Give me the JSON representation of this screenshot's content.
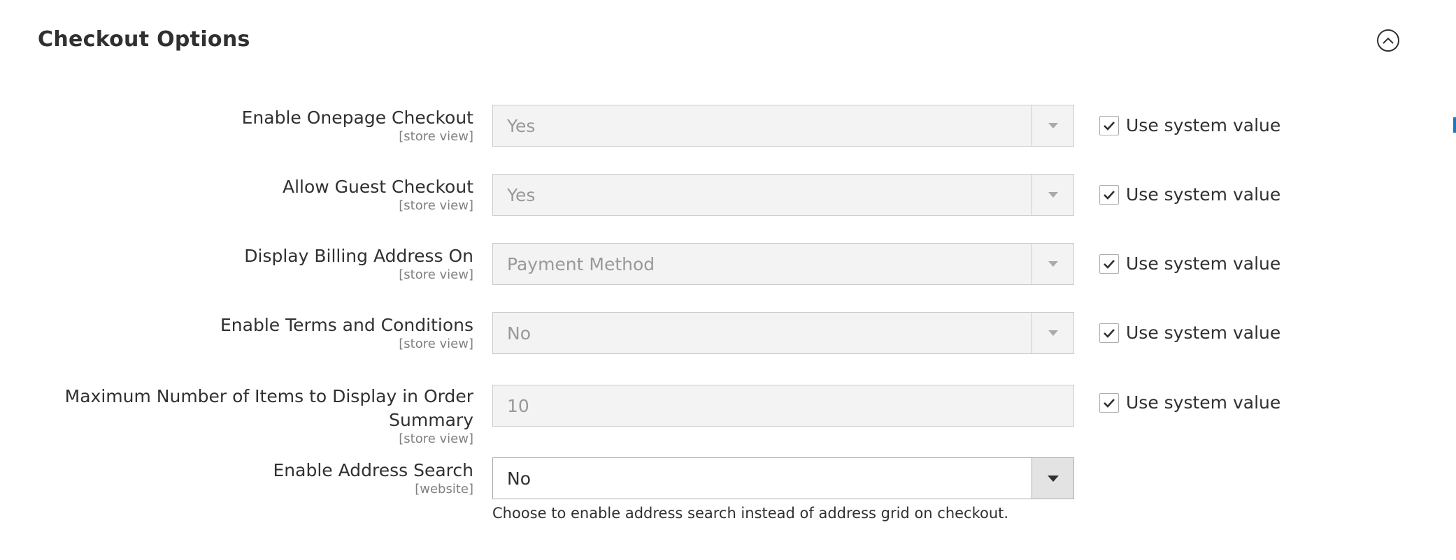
{
  "section": {
    "title": "Checkout Options"
  },
  "fields": [
    {
      "label": "Enable Onepage Checkout",
      "scope": "[store view]",
      "value": "Yes",
      "use_system_value": "Use system value"
    },
    {
      "label": "Allow Guest Checkout",
      "scope": "[store view]",
      "value": "Yes",
      "use_system_value": "Use system value"
    },
    {
      "label": "Display Billing Address On",
      "scope": "[store view]",
      "value": "Payment Method",
      "use_system_value": "Use system value"
    },
    {
      "label": "Enable Terms and Conditions",
      "scope": "[store view]",
      "value": "No",
      "use_system_value": "Use system value"
    },
    {
      "label_line1": "Maximum Number of Items to Display in Order",
      "label_line2": "Summary",
      "scope": "[store view]",
      "value": "10",
      "use_system_value": "Use system value"
    },
    {
      "label": "Enable Address Search",
      "scope": "[website]",
      "value": "No",
      "note": "Choose to enable address search instead of address grid on checkout."
    }
  ],
  "colors": {
    "text": "#303030",
    "disabled_text": "#999999",
    "disabled_bg": "#f3f3f3",
    "border": "#cccccc"
  }
}
